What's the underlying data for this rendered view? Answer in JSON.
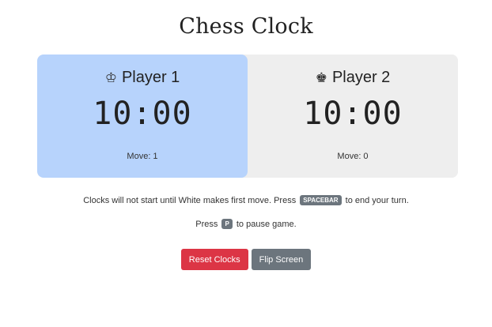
{
  "title": "Chess Clock",
  "players": [
    {
      "icon": "white-king-icon",
      "icon_char": "♔",
      "name": "Player 1",
      "time": "10:00",
      "move_label": "Move: 1",
      "active": true
    },
    {
      "icon": "black-king-icon",
      "icon_char": "♚",
      "name": "Player 2",
      "time": "10:00",
      "move_label": "Move: 0",
      "active": false
    }
  ],
  "info": {
    "line1_before": "Clocks will not start until White makes first move. Press",
    "line1_key": "SPACEBAR",
    "line1_after": "to end your turn.",
    "line2_before": "Press",
    "line2_key": "P",
    "line2_after": "to pause game."
  },
  "buttons": {
    "reset_label": "Reset Clocks",
    "flip_label": "Flip Screen"
  },
  "colors": {
    "active_clock": "#b7d3fc",
    "inactive_clock": "#eeeeee",
    "reset_button": "#dc3545",
    "flip_button": "#6c757d"
  }
}
